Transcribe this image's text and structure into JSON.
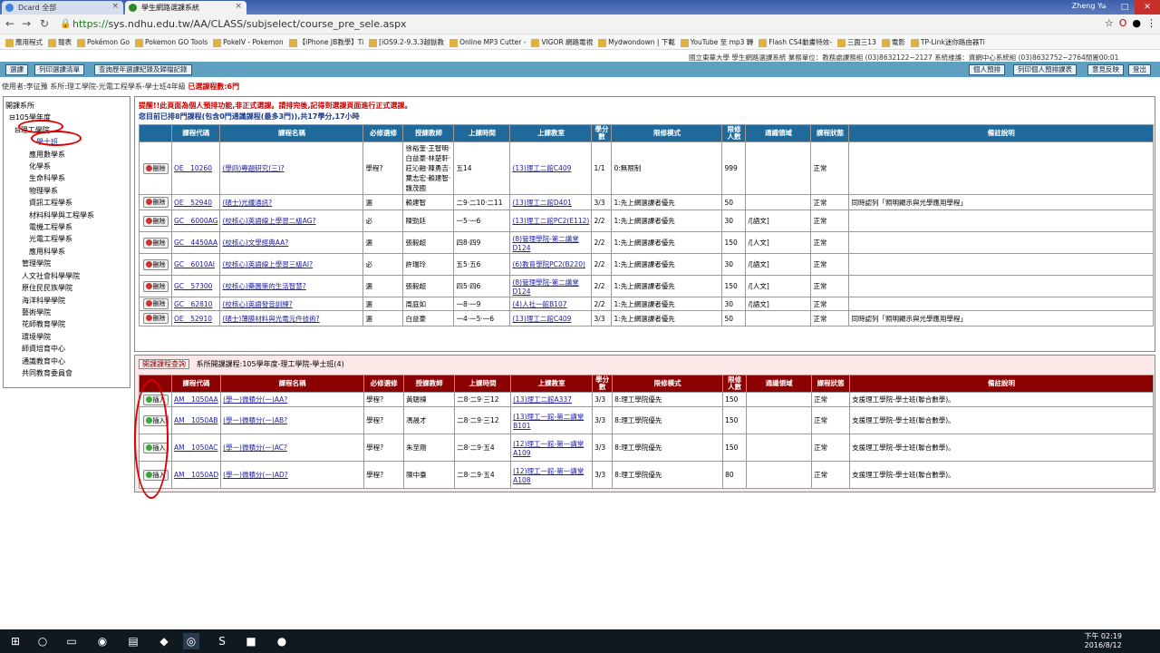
{
  "browser": {
    "tabs": [
      {
        "label": "Dcard 全部"
      },
      {
        "label": "學生網路選課系統"
      }
    ],
    "user": "Zheng Yu",
    "url_scheme": "https://",
    "url_rest": "sys.ndhu.edu.tw/AA/CLASS/subjselect/course_pre_sele.aspx",
    "bookmarks": [
      "應用程式",
      "報表",
      "Pokémon Go",
      "Pokemon GO Tools",
      "PokeIV - Pokemon",
      "【iPhone JB教學】Ti",
      "[iOS9.2-9.3.3越獄教",
      "Online MP3 Cutter -",
      "VIGOR 網路電視",
      "Mydwondown | 下載",
      "YouTube 至 mp3 轉",
      "Flash CS4動畫特效-",
      "三面三13",
      "電影",
      "TP-Link迷你路由器Ti"
    ]
  },
  "system": {
    "buttons": [
      "選課",
      "列印選課清單",
      "查詢歷年選課紀錄及歸檔記錄"
    ],
    "info": "國立東華大學 學生網路選課系統 業務單位：教務處課務組 (03)8632122~2127 系統維護：資網中心系統組 (03)8632752~2764閒置00:01",
    "right_buttons": [
      "個人預排",
      "列印個人預排課表",
      "意見反映",
      "登出"
    ]
  },
  "userline": {
    "text": "使用者:李征豫 系所:理工學院-光電工程學系-學士班4年級",
    "count": "已選課程數:6門"
  },
  "tree": {
    "title": "開課系所",
    "year": "⊟105學年度",
    "college": "⊟理工學院",
    "items": [
      "學士班",
      "應用數學系",
      "化學系",
      "生命科學系",
      "物理學系",
      "資訊工程學系",
      "材料科學與工程學系",
      "電機工程學系",
      "光電工程學系",
      "應用科學系"
    ],
    "others": [
      "管理學院",
      "人文社會科學學院",
      "原住民民族學院",
      "海洋科學學院",
      "藝術學院",
      "花師教育學院",
      "環境學院",
      "師資培育中心",
      "通識教育中心",
      "共同教育委員會"
    ]
  },
  "main": {
    "notice1": "提醒!!此頁面為個人預排功能,非正式選課。請排完後,記得到選課頁面進行正式選課。",
    "notice2": "您目前已排8門課程(包含0門通識課程(最多3門)),共17學分,17小時",
    "headers": [
      "",
      "課程代碼",
      "課程名稱",
      "必修選修",
      "授課教師",
      "上課時間",
      "上課教室",
      "學分數",
      "限修模式",
      "限修人數",
      "通識領域",
      "課程狀態",
      "備註說明"
    ],
    "delete_label": "刪除",
    "rows": [
      [
        "OE__10260",
        "(學四)專題研究(三)?",
        "學程?",
        "徐裕奎·王智明·白益豪·林楚軒·莊沁融·陳勇吉·葉志宏·賴建智·魏茂國",
        "五14",
        "(13)理工二館C409",
        "1/1",
        "0:無限制",
        "999",
        "",
        "正常",
        ""
      ],
      [
        "OE__52940",
        "(碩士)光纖通訊?",
        "選",
        "賴建智",
        "二9·二10·二11",
        "(13)理工二館D401",
        "3/3",
        "1:先上網選課者優先",
        "50",
        "",
        "正常",
        "同時認列「照明顯示與光學應用學程」"
      ],
      [
        "GC__6000AG",
        "(校核心)英語線上學習二級AG?",
        "必",
        "陳勁廷",
        "一5·一6",
        "(13)理工二館PC2(E112)",
        "2/2",
        "1:先上網選課者優先",
        "30",
        "/[語文]",
        "正常",
        ""
      ],
      [
        "GC__4450AA",
        "(校核心)文學經典AA?",
        "選",
        "張毅超",
        "四8·四9",
        "(8)管理學院-第二講堂D124",
        "2/2",
        "1:先上網選課者優先",
        "150",
        "/[人文]",
        "正常",
        ""
      ],
      [
        "GC__6010AI",
        "(校核心)英語線上學習三級AI?",
        "必",
        "許瑞玲",
        "五5·五6",
        "(6)教育學院PC2(B220)",
        "2/2",
        "1:先上網選課者優先",
        "30",
        "/[語文]",
        "正常",
        ""
      ],
      [
        "GC__57300",
        "(校核心)藥園策的生活智慧?",
        "選",
        "張毅超",
        "四5·四6",
        "(8)管理學院-第二講堂D124",
        "2/2",
        "1:先上網選課者優先",
        "150",
        "/[人文]",
        "正常",
        ""
      ],
      [
        "GC__62810",
        "(校核心)英語發音訓練?",
        "選",
        "周庭如",
        "一8·一9",
        "(4)人社一館B107",
        "2/2",
        "1:先上網選課者優先",
        "30",
        "/[語文]",
        "正常",
        ""
      ],
      [
        "OE__52910",
        "(碩士)薄膜材料與光電元件技術?",
        "選",
        "白益豪",
        "一4·一5·一6",
        "(13)理工二館C409",
        "3/3",
        "1:先上網選課者優先",
        "50",
        "",
        "正常",
        "同時認列「照明顯示與光學應用學程」"
      ]
    ]
  },
  "offer": {
    "button": "開課課程查詢",
    "caption": "系所開課課程:105學年度-理工學院-學士班(4)",
    "insert_label": "插入",
    "rows": [
      [
        "AM__1050AA",
        "(學一)微積分(一)AA?",
        "學程?",
        "黃聰棟",
        "二8·二9·三12",
        "(13)理工二館A337",
        "3/3",
        "8:理工學院優先",
        "150",
        "",
        "正常",
        "支援理工學院-學士班(聯合數學)。"
      ],
      [
        "AM__1050AB",
        "(學一)微積分(一)AB?",
        "學程?",
        "馮晟才",
        "二8·二9·三12",
        "(13)理工一館-第二講堂B101",
        "3/3",
        "8:理工學院優先",
        "150",
        "",
        "正常",
        "支援理工學院-學士班(聯合數學)。"
      ],
      [
        "AM__1050AC",
        "(學一)微積分(一)AC?",
        "學程?",
        "朱至剛",
        "二8·二9·五4",
        "(12)理工一館-第一講堂A109",
        "3/3",
        "8:理工學院優先",
        "150",
        "",
        "正常",
        "支援理工學院-學士班(聯合數學)。"
      ],
      [
        "AM__1050AD",
        "(學一)微積分(一)AD?",
        "學程?",
        "陳中臺",
        "二8·二9·五4",
        "(12)理工一館-第一講堂A108",
        "3/3",
        "8:理工學院優先",
        "80",
        "",
        "正常",
        "支援理工學院-學士班(聯合數學)。"
      ]
    ]
  },
  "taskbar": {
    "time": "下午 02:19",
    "date": "2016/8/12"
  }
}
